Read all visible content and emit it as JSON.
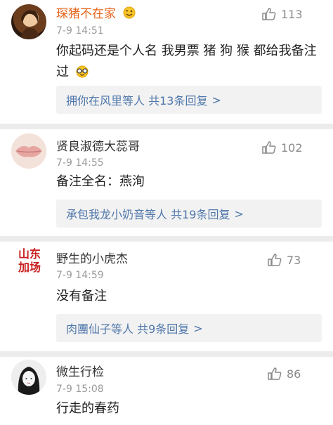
{
  "comments": [
    {
      "username": "琛猪不在家",
      "badge_icon": "emoji-wink-icon",
      "time": "7-9 14:51",
      "text": "你起码还是个人名 我男票 猪 狗 猴 都给我备注过",
      "likes": "113",
      "replies_label": "拥你在风里等人 共13条回复",
      "replies_chevron": ">"
    },
    {
      "username": "贤良淑德大蕊哥",
      "time": "7-9 14:55",
      "text": "备注全名：燕洵",
      "likes": "102",
      "replies_label": "承包我龙小奶音等人 共19条回复",
      "replies_chevron": ">"
    },
    {
      "username": "野生的小虎杰",
      "avatar_text_line1": "山东",
      "avatar_text_line2": "加场",
      "time": "7-9 14:59",
      "text": "没有备注",
      "likes": "73",
      "replies_label": "肉團仙子等人 共9条回复",
      "replies_chevron": ">"
    },
    {
      "username": "微生行检",
      "time": "7-9 15:08",
      "text": "行走的春药",
      "likes": "86"
    }
  ],
  "colors": {
    "username_highlight": "#e8641b",
    "reply_link": "#4f77ab",
    "reply_bg": "#f2f2f2",
    "meta": "#9a9a9a",
    "avatar_tag": "#c8201f"
  }
}
